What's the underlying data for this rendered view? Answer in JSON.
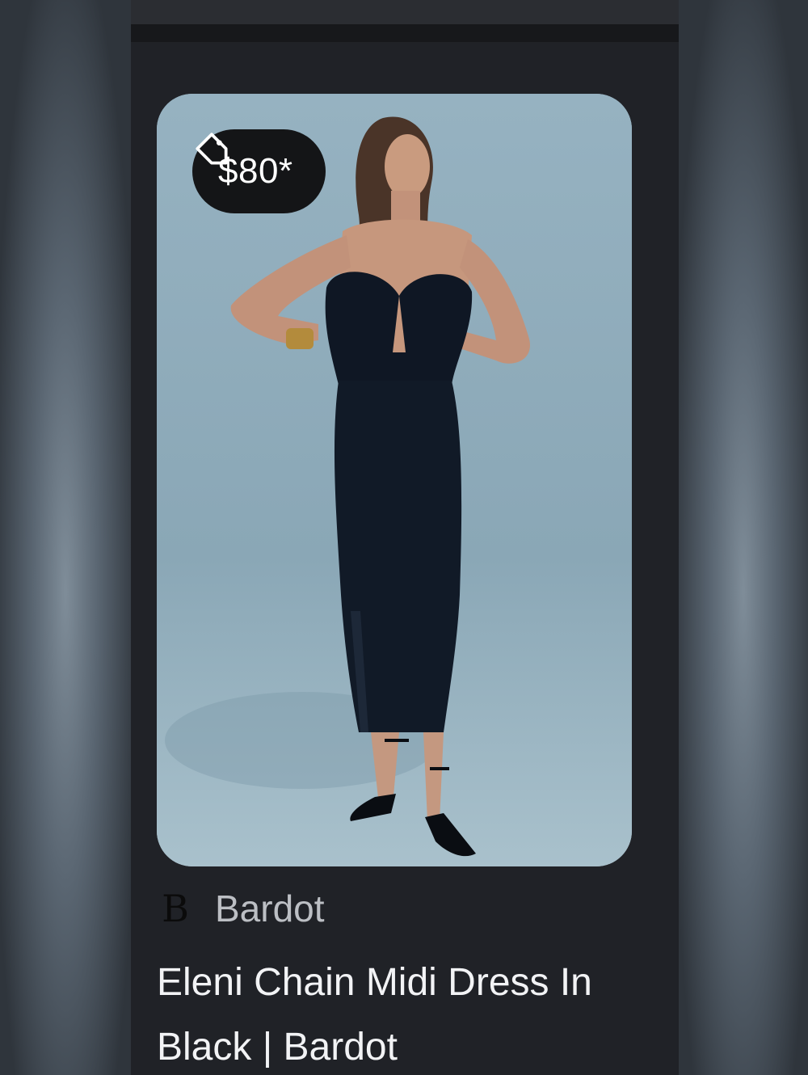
{
  "listing": {
    "price": "$80*",
    "price_icon": "price-tag-icon",
    "brand": {
      "logo_letter": "B",
      "name": "Bardot"
    },
    "title": "Eleni Chain Midi Dress In Black | Bardot"
  },
  "colors": {
    "card_background": "#202227",
    "photo_background": "#9bb6c4",
    "pill_background": "#141517",
    "title_text": "#f2f3f5",
    "brand_text": "#bcbfc4"
  }
}
